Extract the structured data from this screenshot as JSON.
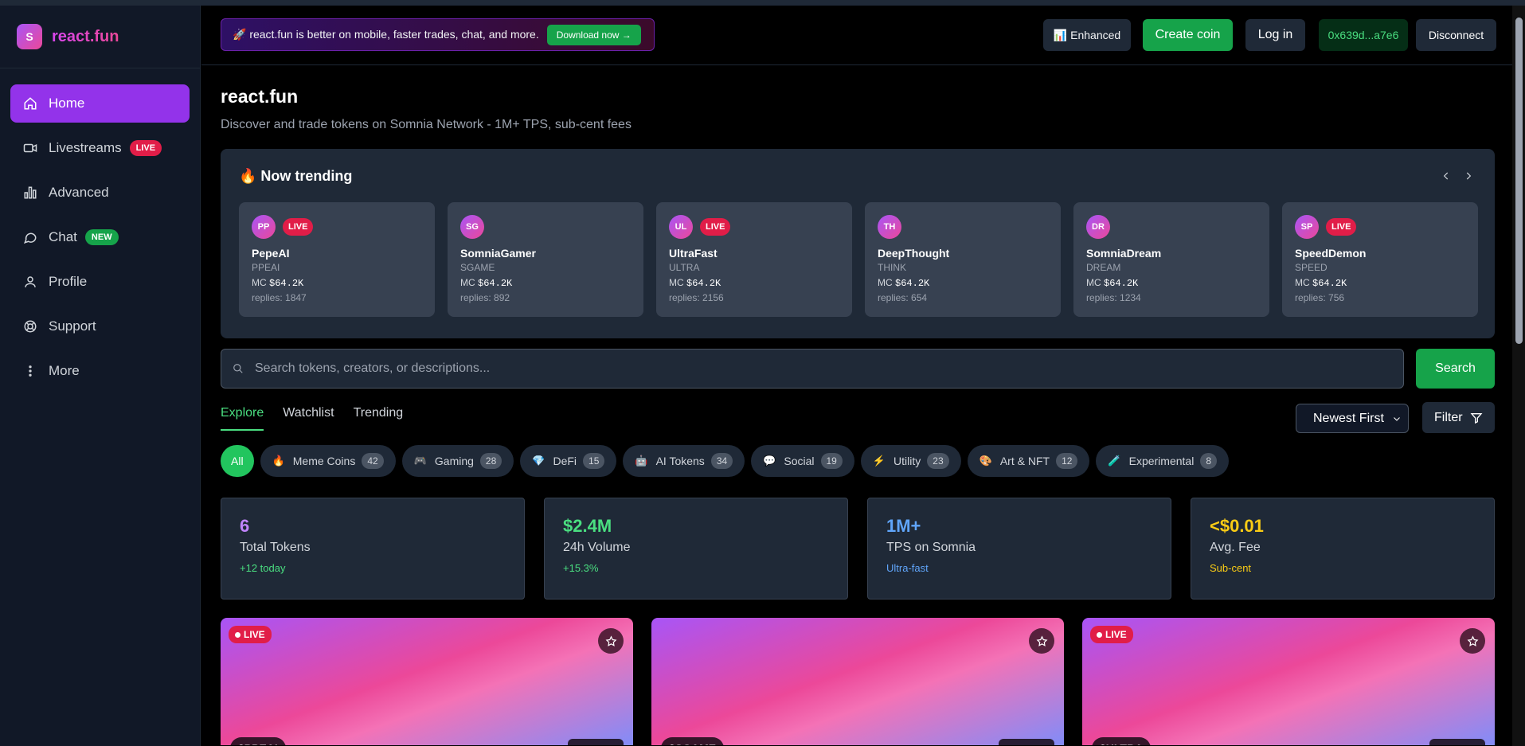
{
  "brand": {
    "logo_letter": "S",
    "name": "react.fun"
  },
  "sidebar": {
    "items": [
      {
        "label": "Home",
        "icon": "home-icon"
      },
      {
        "label": "Livestreams",
        "icon": "video-icon",
        "badge": "LIVE"
      },
      {
        "label": "Advanced",
        "icon": "chart-icon"
      },
      {
        "label": "Chat",
        "icon": "chat-icon",
        "badge": "NEW"
      },
      {
        "label": "Profile",
        "icon": "user-icon"
      },
      {
        "label": "Support",
        "icon": "support-icon"
      },
      {
        "label": "More",
        "icon": "more-icon"
      }
    ]
  },
  "header": {
    "promo_text": "🚀 react.fun is better on mobile, faster trades, chat, and more.",
    "promo_button": "Download now →",
    "enhanced": "📊 Enhanced",
    "create_coin": "Create coin",
    "login": "Log in",
    "wallet": "0x639d...a7e6",
    "disconnect": "Disconnect"
  },
  "page": {
    "title": "react.fun",
    "subtitle": "Discover and trade tokens on Somnia Network - 1M+ TPS, sub-cent fees"
  },
  "trending": {
    "title": "🔥 Now trending",
    "cards": [
      {
        "initials": "PP",
        "live": "LIVE",
        "name": "PepeAI",
        "symbol": "PPEAI",
        "mc_label": "MC",
        "mc": "$64.2K",
        "replies": "replies: 1847"
      },
      {
        "initials": "SG",
        "live": "",
        "name": "SomniaGamer",
        "symbol": "SGAME",
        "mc_label": "MC",
        "mc": "$64.2K",
        "replies": "replies: 892"
      },
      {
        "initials": "UL",
        "live": "LIVE",
        "name": "UltraFast",
        "symbol": "ULTRA",
        "mc_label": "MC",
        "mc": "$64.2K",
        "replies": "replies: 2156"
      },
      {
        "initials": "TH",
        "live": "",
        "name": "DeepThought",
        "symbol": "THINK",
        "mc_label": "MC",
        "mc": "$64.2K",
        "replies": "replies: 654"
      },
      {
        "initials": "DR",
        "live": "",
        "name": "SomniaDream",
        "symbol": "DREAM",
        "mc_label": "MC",
        "mc": "$64.2K",
        "replies": "replies: 1234"
      },
      {
        "initials": "SP",
        "live": "LIVE",
        "name": "SpeedDemon",
        "symbol": "SPEED",
        "mc_label": "MC",
        "mc": "$64.2K",
        "replies": "replies: 756"
      }
    ]
  },
  "search": {
    "placeholder": "Search tokens, creators, or descriptions...",
    "value": "",
    "button": "Search"
  },
  "tabs": [
    "Explore",
    "Watchlist",
    "Trending"
  ],
  "sort": {
    "selected": "Newest First"
  },
  "filter": {
    "label": "Filter"
  },
  "categories": [
    {
      "emoji": "",
      "label": "All",
      "count": ""
    },
    {
      "emoji": "🔥",
      "label": "Meme Coins",
      "count": "42"
    },
    {
      "emoji": "🎮",
      "label": "Gaming",
      "count": "28"
    },
    {
      "emoji": "💎",
      "label": "DeFi",
      "count": "15"
    },
    {
      "emoji": "🤖",
      "label": "AI Tokens",
      "count": "34"
    },
    {
      "emoji": "💬",
      "label": "Social",
      "count": "19"
    },
    {
      "emoji": "⚡",
      "label": "Utility",
      "count": "23"
    },
    {
      "emoji": "🎨",
      "label": "Art & NFT",
      "count": "12"
    },
    {
      "emoji": "🧪",
      "label": "Experimental",
      "count": "8"
    }
  ],
  "stats": [
    {
      "value": "6",
      "label": "Total Tokens",
      "sub": "+12 today",
      "color": "#c084fc",
      "sub_color": "#4ade80"
    },
    {
      "value": "$2.4M",
      "label": "24h Volume",
      "sub": "+15.3%",
      "color": "#4ade80",
      "sub_color": "#4ade80"
    },
    {
      "value": "1M+",
      "label": "TPS on Somnia",
      "sub": "Ultra-fast",
      "color": "#60a5fa",
      "sub_color": "#60a5fa"
    },
    {
      "value": "<$0.01",
      "label": "Avg. Fee",
      "sub": "Sub-cent",
      "color": "#facc15",
      "sub_color": "#facc15"
    }
  ],
  "token_cards": [
    {
      "live": "LIVE",
      "symbol": "$PPEAI"
    },
    {
      "live": "",
      "symbol": "$SGAME"
    },
    {
      "live": "LIVE",
      "symbol": "$ULTRA"
    }
  ]
}
